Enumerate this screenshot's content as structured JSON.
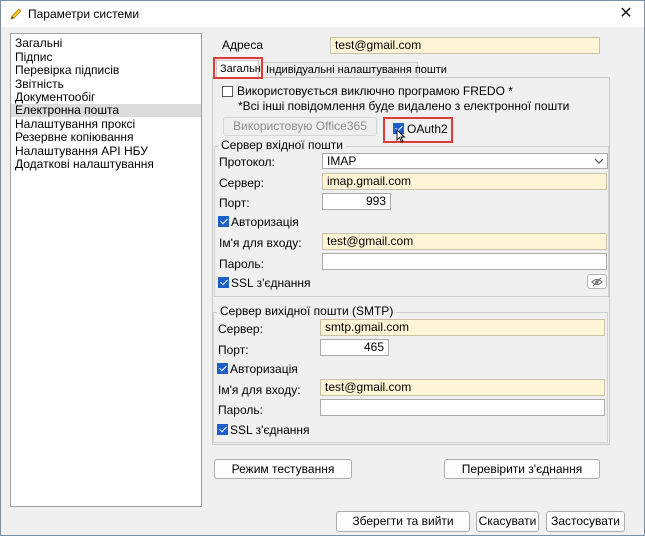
{
  "window": {
    "title": "Параметри системи",
    "icon": "pencil-icon"
  },
  "sidebar": {
    "items": [
      {
        "label": "Загальні"
      },
      {
        "label": "Підпис"
      },
      {
        "label": "Перевірка підписів"
      },
      {
        "label": "Звітність"
      },
      {
        "label": "Документообіг"
      },
      {
        "label": "Електронна пошта",
        "selected": true
      },
      {
        "label": "Налаштування проксі"
      },
      {
        "label": "Резервне копіювання"
      },
      {
        "label": "Налаштування API НБУ"
      },
      {
        "label": "Додаткові налаштування"
      }
    ]
  },
  "address": {
    "label": "Адреса",
    "value": "test@gmail.com"
  },
  "tabs": [
    {
      "label": "Загальні",
      "active": true
    },
    {
      "label": "Індивідуальні налаштування пошти"
    }
  ],
  "fredo": {
    "label": "Використовується виключно програмою FREDO *",
    "checked": false,
    "note": "*Всі інші повідомлення буде видалено з електронної пошти"
  },
  "office365_button": "Використовую Office365",
  "oauth": {
    "label": "OAuth2",
    "checked": true
  },
  "incoming": {
    "title": "Сервер вхідної пошти",
    "protocol_label": "Протокол:",
    "protocol_value": "IMAP",
    "server_label": "Сервер:",
    "server_value": "imap.gmail.com",
    "port_label": "Порт:",
    "port_value": "993",
    "auth_label": "Авторизація",
    "auth_checked": true,
    "login_label": "Ім'я для входу:",
    "login_value": "test@gmail.com",
    "password_label": "Пароль:",
    "password_value": "",
    "ssl_label": "SSL з'єднання",
    "ssl_checked": true
  },
  "outgoing": {
    "title": "Сервер вихідної пошти (SMTP)",
    "server_label": "Сервер:",
    "server_value": "smtp.gmail.com",
    "port_label": "Порт:",
    "port_value": "465",
    "auth_label": "Авторизація",
    "auth_checked": true,
    "login_label": "Ім'я для входу:",
    "login_value": "test@gmail.com",
    "password_label": "Пароль:",
    "password_value": "",
    "ssl_label": "SSL з'єднання",
    "ssl_checked": true
  },
  "buttons": {
    "test_mode": "Режим тестування",
    "check_connection": "Перевірити з'єднання",
    "save_exit": "Зберегти та вийти",
    "cancel": "Скасувати",
    "apply": "Застосувати"
  },
  "colors": {
    "highlight_field": "#fef5d6",
    "annotation_red": "#e03a3a",
    "checkbox_blue": "#1d5fc7",
    "selected_item": "#dcdcdc"
  }
}
